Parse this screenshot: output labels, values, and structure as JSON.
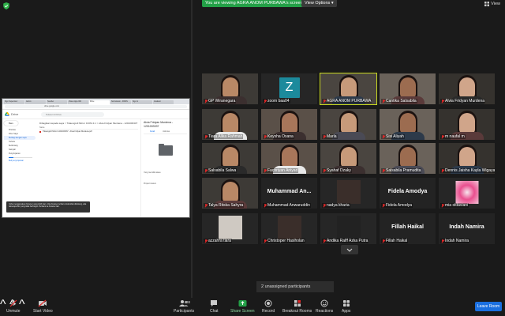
{
  "banner": "You are viewing AGRA ANOM PURBAWA's screen",
  "view_options": "View Options ▾",
  "view_label": "View",
  "shared": {
    "tabs": [
      "Sign Supervisor",
      "Admin",
      "Teacher",
      "Video Apps 000",
      "Drive",
      "Submission - FRIDS",
      "Sign In",
      "Gradient"
    ],
    "url": "drive.google.com",
    "drive_name": "Drive",
    "search_placeholder": "Telusuri di Drive",
    "new_label": "Baru",
    "side_items": [
      "Prioritas",
      "Drive Saya",
      "Berbagi dengan saya",
      "Terbaru",
      "Berbintang",
      "Sampah",
      "Penyimpanan"
    ],
    "storage_text": "Beli penyimpanan",
    "breadcrumb": "Dibagikan kepada saya  >  Tidaungroll Mirror ICOM 4.1  >  Alvia Fridyan Murdena - 1201003337",
    "col_head": "Nama",
    "file": "Tidaungroll Mirror 1201003337 - Alvia Fridyan Murdena.pdf",
    "panel_title": "Alvia Fridyan Murdena - 1201003337",
    "panel_tabs": [
      "Detail",
      "Aktivitas"
    ],
    "panel_access": "Yang memiliki akses",
    "panel_props": "Properti sistem",
    "toast": "Coba menggunakan browser yang lebih baru. Jika browser terbaru Anda tidak didukung, ada beberapa fitur yang tidak berfungsi. Perbarui ke browser lain."
  },
  "participants": [
    {
      "name": "GP Wiranegara",
      "type": "video"
    },
    {
      "name": "zoom baa04",
      "type": "letter",
      "letter": "Z"
    },
    {
      "name": "AGRA ANOM PURBAWA",
      "type": "video",
      "active": true
    },
    {
      "name": "Cantika Salsabila",
      "type": "video"
    },
    {
      "name": "Alvia Fridyan Murdena",
      "type": "video"
    },
    {
      "name": "Tiara Alika Rahmah",
      "type": "video"
    },
    {
      "name": "Keysha Oxana",
      "type": "video"
    },
    {
      "name": "Marla",
      "type": "video"
    },
    {
      "name": "Sisi Aliyah",
      "type": "video"
    },
    {
      "name": "m naufal m",
      "type": "video"
    },
    {
      "name": "Salsabila Salwa",
      "type": "video"
    },
    {
      "name": "Fachriyan Aniyad",
      "type": "video"
    },
    {
      "name": "Syahaf Dzaky",
      "type": "video"
    },
    {
      "name": "Salsabila Pramudita",
      "type": "video"
    },
    {
      "name": "Dennis Jaisha Kayla Wigaya",
      "type": "video"
    },
    {
      "name": "Talya Ritska Sahyra",
      "type": "video"
    },
    {
      "name": "Muhammad Anwaruddin",
      "type": "name",
      "display": "Muhammad An..."
    },
    {
      "name": "nadya kharia",
      "type": "photo"
    },
    {
      "name": "Fidela Amodya",
      "type": "name",
      "display": "Fidela Amodya"
    },
    {
      "name": "mia oktaviani",
      "type": "pink"
    },
    {
      "name": "azzahra tiara",
      "type": "photo"
    },
    {
      "name": "Christoper Hasiholan",
      "type": "photo"
    },
    {
      "name": "Andika Ralff Azka Putra",
      "type": "photo"
    },
    {
      "name": "Fillah Haikal",
      "type": "name",
      "display": "Fillah Haikal"
    },
    {
      "name": "Indah Namira",
      "type": "name",
      "display": "Indah Namira"
    }
  ],
  "unassigned": "2 unassigned participants",
  "toolbar": {
    "unmute": "Unmute",
    "start_video": "Start Video",
    "participants": "Participants",
    "participants_count": "38",
    "chat": "Chat",
    "share_screen": "Share Screen",
    "record": "Record",
    "breakout_rooms": "Breakout Rooms",
    "reactions": "Reactions",
    "apps": "Apps",
    "leave": "Leave Room"
  },
  "colors": {
    "share_green": "#23a047",
    "active_border": "#c8d820",
    "leave_blue": "#1a6fe0",
    "muted_red": "#e02828"
  }
}
